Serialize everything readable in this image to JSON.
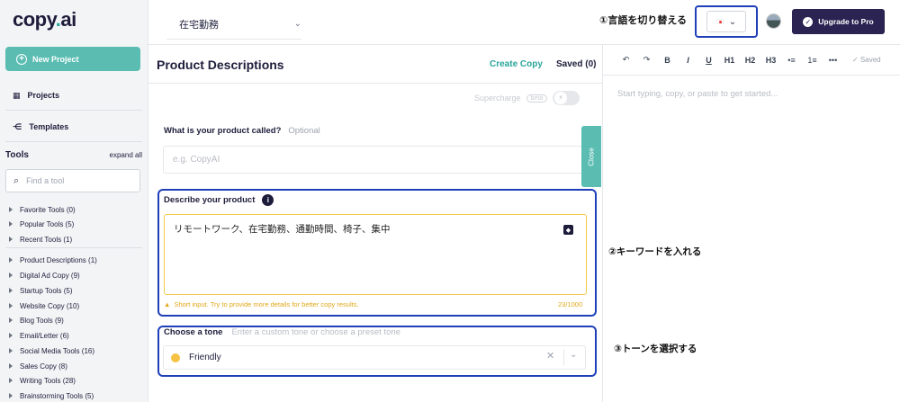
{
  "brand": {
    "logo_left": "copy",
    "logo_dot": ".",
    "logo_right": "ai"
  },
  "sidebar": {
    "new_project": "New Project",
    "projects": "Projects",
    "templates": "Templates",
    "tools_title": "Tools",
    "expand_all": "expand all",
    "find_placeholder": "Find a tool",
    "tools": [
      "Favorite Tools (0)",
      "Popular Tools (5)",
      "Recent Tools (1)",
      "Product Descriptions (1)",
      "Digital Ad Copy (9)",
      "Startup Tools (5)",
      "Website Copy (10)",
      "Blog Tools (9)",
      "Email/Letter (6)",
      "Social Media Tools (16)",
      "Sales Copy (8)",
      "Writing Tools (28)",
      "Brainstorming Tools (5)"
    ]
  },
  "header": {
    "workspace": "在宅勤務",
    "annotation_language": "①言語を切り替える",
    "upgrade": "Upgrade to Pro"
  },
  "main": {
    "title": "Product Descriptions",
    "tab_create": "Create Copy",
    "tab_saved": "Saved (0)",
    "supercharge": "Supercharge",
    "beta": "beta",
    "close": "Close",
    "q_product": "What is your product called?",
    "q_optional": "Optional",
    "product_placeholder": "e.g. CopyAI",
    "describe_label": "Describe your product",
    "describe_value": "リモートワーク、在宅勤務、通勤時間、椅子、集中",
    "warning": "Short input. Try to provide more details for better copy results.",
    "char_count": "23/1000",
    "tone_label": "Choose a tone",
    "tone_placeholder": "Enter a custom tone or choose a preset tone",
    "tone_value": "Friendly"
  },
  "editor": {
    "toolbar": [
      "↶",
      "↷",
      "B",
      "I",
      "U",
      "H1",
      "H2",
      "H3",
      "•≡",
      "1≡",
      "•••"
    ],
    "saved": "✓ Saved",
    "placeholder": "Start typing, copy, or paste to get started..."
  },
  "annotations": {
    "keywords": "②キーワードを入れる",
    "tone": "③トーンを選択する"
  },
  "colors": {
    "teal": "#5bbdb2",
    "navy": "#2b2352",
    "highlight": "#1f3fb8",
    "warning": "#e2a818"
  }
}
